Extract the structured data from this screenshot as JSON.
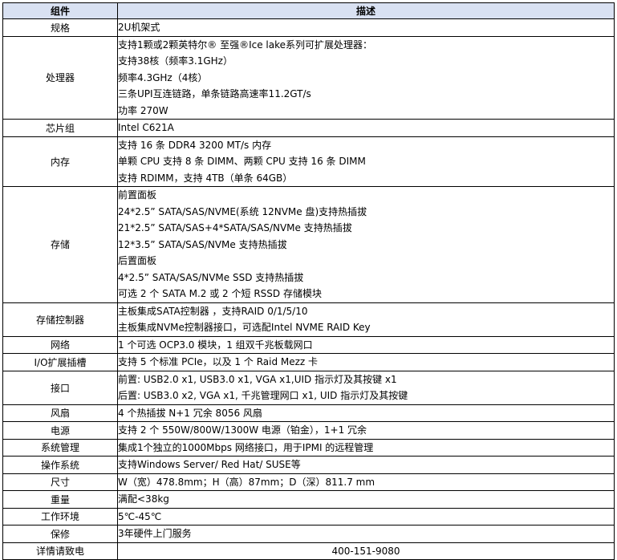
{
  "header": {
    "component": "组件",
    "description": "描述"
  },
  "rows": [
    {
      "component": "规格",
      "lines": [
        "2U机架式"
      ]
    },
    {
      "component": "处理器",
      "lines": [
        "支持1颗或2颗英特尔® 至强®Ice lake系列可扩展处理器：",
        "支持38核（频率3.1GHz）",
        "频率4.3GHz（4核）",
        "三条UPI互连链路，单条链路高速率11.2GT/s",
        "功率 270W"
      ]
    },
    {
      "component": "芯片组",
      "lines": [
        "Intel C621A"
      ]
    },
    {
      "component": "内存",
      "lines": [
        "支持 16 条 DDR4 3200 MT/s 内存",
        "单颗 CPU 支持 8 条 DIMM、两颗 CPU 支持 16 条 DIMM",
        "支持 RDIMM，支持 4TB（单条 64GB）"
      ]
    },
    {
      "component": "存储",
      "lines": [
        "前置面板",
        "24*2.5”  SATA/SAS/NVME(系统 12NVMe 盘)支持热插拔",
        "21*2.5”  SATA/SAS+4*SATA/SAS/NVMe 支持热插拔",
        "12*3.5”  SATA/SAS/NVMe 支持热插拔",
        "后置面板",
        "4*2.5”  SATA/SAS/NVMe SSD 支持热插拔",
        "可选 2 个 SATA M.2 或 2 个短 RSSD 存储模块"
      ]
    },
    {
      "component": "存储控制器",
      "lines": [
        "主板集成SATA控制器 ，支持RAID 0/1/5/10",
        "主板集成NVMe控制器接口，可选配Intel NVME RAID Key"
      ]
    },
    {
      "component": "网络",
      "lines": [
        "1 个可选 OCP3.0 模块，1 组双千兆板载网口"
      ]
    },
    {
      "component": "I/O扩展插槽",
      "lines": [
        "支持 5 个标准 PCIe，以及 1 个 Raid Mezz 卡"
      ]
    },
    {
      "component": "接口",
      "lines": [
        "前置: USB2.0 x1, USB3.0 x1, VGA x1,UID 指示灯及其按键 x1",
        "后置: USB3.0 x2, VGA x1, 千兆管理网口 x1, UID 指示灯及其按键"
      ]
    },
    {
      "component": "风扇",
      "lines": [
        "4 个热插拔 N+1 冗余 8056 风扇"
      ]
    },
    {
      "component": "电源",
      "lines": [
        "支持 2 个 550W/800W/1300W 电源（铂金），1+1 冗余"
      ]
    },
    {
      "component": "系统管理",
      "lines": [
        "集成1个独立的1000Mbps 网络接口，用于IPMI 的远程管理"
      ]
    },
    {
      "component": "操作系统",
      "lines": [
        "支持Windows Server/ Red Hat/ SUSE等"
      ]
    },
    {
      "component": "尺寸",
      "lines": [
        "W（宽）478.8mm；H（高）87mm；D（深）811.7 mm"
      ]
    },
    {
      "component": "重量",
      "lines": [
        "满配<38kg"
      ]
    },
    {
      "component": "工作环境",
      "lines": [
        "5℃-45℃"
      ]
    },
    {
      "component": "保修",
      "lines": [
        "3年硬件上门服务"
      ]
    },
    {
      "component": "详情请致电",
      "lines": [
        "400-151-9080"
      ],
      "center": true
    }
  ]
}
